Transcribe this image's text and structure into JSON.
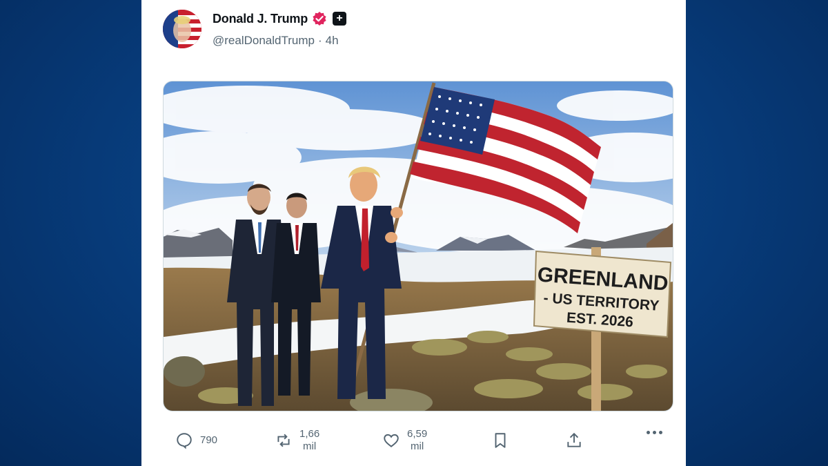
{
  "post": {
    "author_name": "Donald J. Trump",
    "handle": "@realDonaldTrump",
    "separator": "·",
    "time": "4h"
  },
  "image": {
    "sign_line1": "GREENLAND",
    "sign_line2": "- US TERRITORY",
    "sign_line3": "EST. 2026"
  },
  "actions": {
    "replies": "790",
    "reposts_num": "1,66",
    "reposts_unit": "mil",
    "likes_num": "6,59",
    "likes_unit": "mil"
  },
  "colors": {
    "page_bg": "#073a78",
    "verified_badge": "#e0245e",
    "text_primary": "#0f1419",
    "text_secondary": "#536471"
  },
  "icons": [
    "verified-badge-icon",
    "affiliate-badge-icon",
    "reply-icon",
    "repost-icon",
    "like-icon",
    "bookmark-icon",
    "share-icon",
    "more-icon"
  ]
}
